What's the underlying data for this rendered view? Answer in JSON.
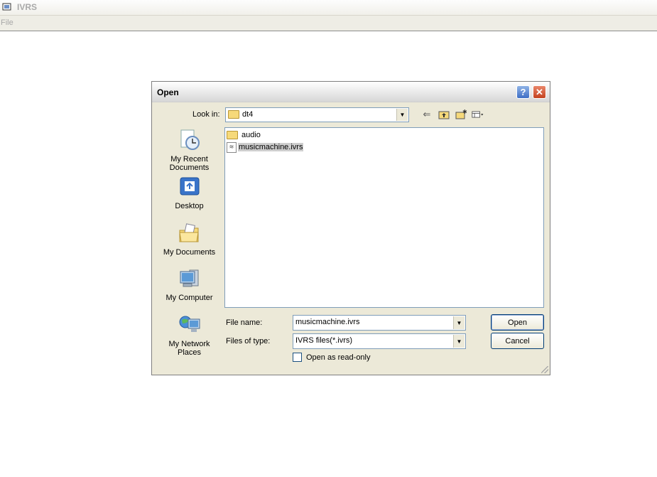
{
  "app": {
    "title": "IVRS",
    "menu": [
      "File"
    ]
  },
  "dialog": {
    "title": "Open",
    "help_glyph": "?",
    "close_glyph": "✕",
    "look_in": {
      "label": "Look in:",
      "value": "dt4"
    },
    "places": [
      {
        "label": "My Recent Documents",
        "icon": "recent-documents-icon"
      },
      {
        "label": "Desktop",
        "icon": "desktop-icon"
      },
      {
        "label": "My Documents",
        "icon": "my-documents-icon"
      },
      {
        "label": "My Computer",
        "icon": "my-computer-icon"
      },
      {
        "label": "My Network Places",
        "icon": "network-places-icon"
      }
    ],
    "files": [
      {
        "name": "audio",
        "type": "folder",
        "selected": false
      },
      {
        "name": "musicmachine.ivrs",
        "type": "file",
        "selected": true
      }
    ],
    "file_name": {
      "label": "File name:",
      "value": "musicmachine.ivrs"
    },
    "file_type": {
      "label": "Files of type:",
      "value": "IVRS files(*.ivrs)"
    },
    "read_only": {
      "label": "Open as read-only",
      "checked": false
    },
    "buttons": {
      "open": "Open",
      "cancel": "Cancel"
    }
  },
  "colors": {
    "dialog_bg": "#ece9d8",
    "selection": "#cecece",
    "field_border": "#7f9db9"
  }
}
